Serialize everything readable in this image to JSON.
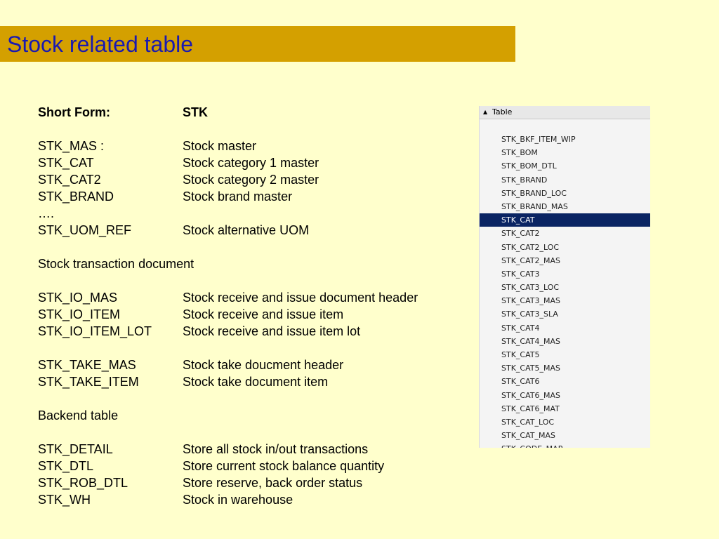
{
  "header": {
    "title": "Stock related table"
  },
  "short_form": {
    "label": "Short Form:",
    "value": "STK"
  },
  "sections": [
    {
      "rows": [
        {
          "code": "STK_MAS  :",
          "desc": "Stock master"
        },
        {
          "code": "STK_CAT",
          "desc": "Stock category 1 master"
        },
        {
          "code": "STK_CAT2",
          "desc": "Stock category 2 master"
        },
        {
          "code": "STK_BRAND",
          "desc": "Stock brand master"
        },
        {
          "code": "….",
          "desc": ""
        },
        {
          "code": "STK_UOM_REF",
          "desc": "Stock alternative UOM"
        }
      ]
    },
    {
      "heading": "Stock transaction document"
    },
    {
      "rows": [
        {
          "code": "STK_IO_MAS",
          "desc": "Stock receive and issue document header"
        },
        {
          "code": "STK_IO_ITEM",
          "desc": "Stock receive and issue item"
        },
        {
          "code": "STK_IO_ITEM_LOT",
          "desc": "Stock receive and issue item lot"
        }
      ]
    },
    {
      "rows": [
        {
          "code": "STK_TAKE_MAS",
          "desc": "Stock take doucment header"
        },
        {
          "code": "STK_TAKE_ITEM",
          "desc": "Stock take document item"
        }
      ]
    },
    {
      "heading": "Backend table"
    },
    {
      "rows": [
        {
          "code": "STK_DETAIL",
          "desc": "Store all stock in/out transactions"
        },
        {
          "code": "STK_DTL",
          "desc": "Store current stock balance quantity"
        },
        {
          "code": "STK_ROB_DTL",
          "desc": "Store reserve, back order status"
        },
        {
          "code": "STK_WH",
          "desc": "Stock in warehouse"
        }
      ]
    }
  ],
  "tree_panel": {
    "header_label": "Table",
    "selected": "STK_CAT",
    "items": [
      "STK_BKF_ITEM_WIP",
      "STK_BOM",
      "STK_BOM_DTL",
      "STK_BRAND",
      "STK_BRAND_LOC",
      "STK_BRAND_MAS",
      "STK_CAT",
      "STK_CAT2",
      "STK_CAT2_LOC",
      "STK_CAT2_MAS",
      "STK_CAT3",
      "STK_CAT3_LOC",
      "STK_CAT3_MAS",
      "STK_CAT3_SLA",
      "STK_CAT4",
      "STK_CAT4_MAS",
      "STK_CAT5",
      "STK_CAT5_MAS",
      "STK_CAT6",
      "STK_CAT6_MAS",
      "STK_CAT6_MAT",
      "STK_CAT_LOC",
      "STK_CAT_MAS",
      "STK_CODE_MAP"
    ]
  },
  "colors": {
    "background": "#FFFFCC",
    "title_bar": "#D4A000",
    "title_text": "#1A1AB0",
    "selection": "#0A2463"
  }
}
